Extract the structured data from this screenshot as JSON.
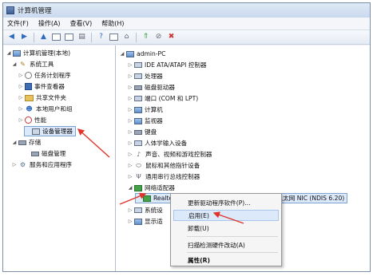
{
  "window": {
    "title": "计算机管理"
  },
  "menu": [
    "文件(F)",
    "操作(A)",
    "查看(V)",
    "帮助(H)"
  ],
  "left_tree": [
    {
      "label": "计算机管理(本地)",
      "icon": "computer-icon",
      "arrow": "◢"
    },
    {
      "label": "系统工具",
      "icon": "tools-icon",
      "arrow": "◢"
    },
    {
      "label": "任务计划程序",
      "icon": "clock-icon",
      "arrow": "▷"
    },
    {
      "label": "事件查看器",
      "icon": "event-viewer-icon",
      "arrow": "▷"
    },
    {
      "label": "共享文件夹",
      "icon": "shared-folder-icon",
      "arrow": "▷"
    },
    {
      "label": "本地用户和组",
      "icon": "users-icon",
      "arrow": "▷"
    },
    {
      "label": "性能",
      "icon": "performance-icon",
      "arrow": "▷"
    },
    {
      "label": "设备管理器",
      "icon": "device-manager-icon",
      "arrow": ""
    },
    {
      "label": "存储",
      "icon": "storage-icon",
      "arrow": "◢"
    },
    {
      "label": "磁盘管理",
      "icon": "disk-management-icon",
      "arrow": ""
    },
    {
      "label": "服务和应用程序",
      "icon": "services-icon",
      "arrow": "▷"
    }
  ],
  "right_tree": [
    {
      "label": "admin-PC",
      "icon": "computer-icon",
      "arrow": "◢"
    },
    {
      "label": "IDE ATA/ATAPI 控制器",
      "icon": "ide-controller-icon",
      "arrow": "▷"
    },
    {
      "label": "处理器",
      "icon": "processor-icon",
      "arrow": "▷"
    },
    {
      "label": "磁盘驱动器",
      "icon": "disk-drive-icon",
      "arrow": "▷"
    },
    {
      "label": "端口 (COM 和 LPT)",
      "icon": "port-icon",
      "arrow": "▷"
    },
    {
      "label": "计算机",
      "icon": "computer-icon",
      "arrow": "▷"
    },
    {
      "label": "监视器",
      "icon": "monitor-icon",
      "arrow": "▷"
    },
    {
      "label": "键盘",
      "icon": "keyboard-icon",
      "arrow": "▷"
    },
    {
      "label": "人体学输入设备",
      "icon": "hid-icon",
      "arrow": "▷"
    },
    {
      "label": "声音、视频和游戏控制器",
      "icon": "sound-icon",
      "arrow": "▷"
    },
    {
      "label": "鼠标和其他指针设备",
      "icon": "mouse-icon",
      "arrow": "▷"
    },
    {
      "label": "通用串行总线控制器",
      "icon": "usb-icon",
      "arrow": "▷"
    },
    {
      "label": "网络适配器",
      "icon": "network-adapter-icon",
      "arrow": "◢"
    },
    {
      "label": "Realtek RTL8168D/8111D 系列 PCI-E 千兆以太网 NIC (NDIS 6.20)",
      "icon": "network-card-icon",
      "arrow": ""
    },
    {
      "label": "系统设",
      "icon": "system-devices-icon",
      "arrow": "▷"
    },
    {
      "label": "显示适",
      "icon": "display-adapter-icon",
      "arrow": "▷"
    }
  ],
  "context_menu": {
    "update_driver": "更新驱动程序软件(P)...",
    "enable": "启用(E)",
    "uninstall": "卸载(U)",
    "scan": "扫描检测硬件改动(A)",
    "properties": "属性(R)"
  },
  "colors": {
    "accent": "#2f6bc1",
    "annotation_arrow": "#e0342b"
  }
}
